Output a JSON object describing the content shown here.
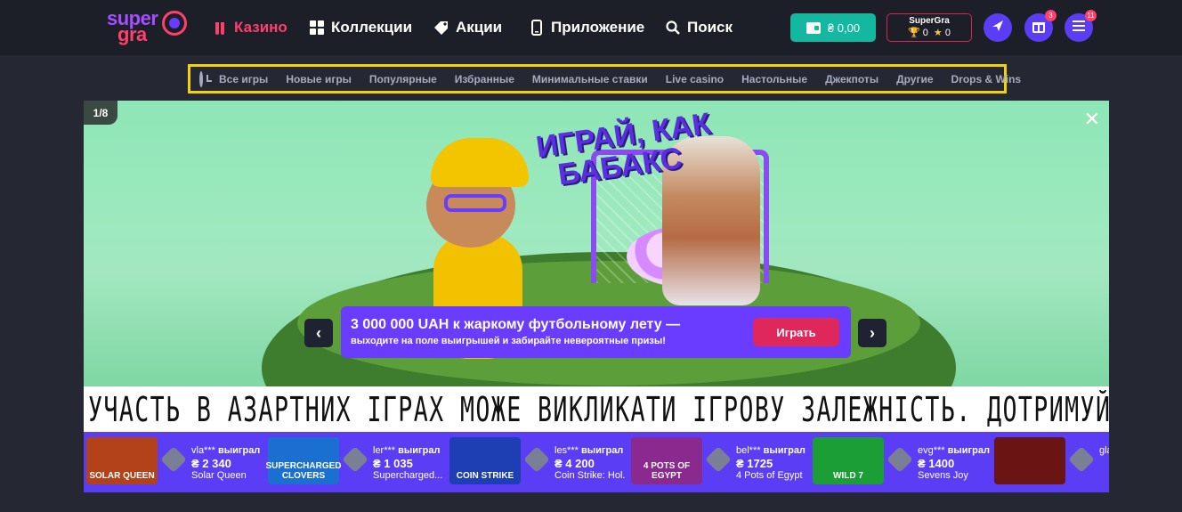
{
  "header": {
    "logo_top": "super",
    "logo_bottom": "gra",
    "nav": [
      {
        "label": "Казино",
        "icon": "casino-icon"
      },
      {
        "label": "Коллекции",
        "icon": "grid-icon"
      },
      {
        "label": "Акции",
        "icon": "tag-icon"
      },
      {
        "label": "Приложение",
        "icon": "phone-icon"
      },
      {
        "label": "Поиск",
        "icon": "search-icon"
      }
    ],
    "balance": "₴ 0,00",
    "profile": {
      "name": "SuperGra",
      "trophies": "0",
      "stars": "0"
    },
    "gift_badge": "3",
    "menu_badge": "11"
  },
  "categories": [
    "Все игры",
    "Новые игры",
    "Популярные",
    "Избранные",
    "Минимальные ставки",
    "Live casino",
    "Настольные",
    "Джекпоты",
    "Другие",
    "Drops & Wins"
  ],
  "banner": {
    "slide_counter": "1/8",
    "headline_line1": "ИГРАЙ, КАК",
    "headline_line2": "БАБАКС",
    "promo_title": "3 000 000 UAH к жаркому футбольному лету —",
    "promo_subtitle": "выходите на поле выигрышей и забирайте невероятные призы!",
    "play_button": "Играть"
  },
  "warning": "УЧАСТЬ В АЗАРТНИХ ІГРАХ МОЖЕ ВИКЛИКАТИ ІГРОВУ ЗАЛЕЖНІСТЬ. ДОТРИМУЙТЕСЯ ПРАВИЛ (ПРИНЦИПІВ) ВІДПОВІДАЛЬНОЇ ГРИ",
  "winners": [
    {
      "user": "vla***",
      "action": "выиграл",
      "amount": "₴ 2 340",
      "game": "Solar Queen",
      "thumb": "SOLAR QUEEN",
      "color": "#b3421b"
    },
    {
      "user": "ler***",
      "action": "выиграл",
      "amount": "₴ 1 035",
      "game": "Supercharged...",
      "thumb": "SUPERCHARGED CLOVERS",
      "color": "#1b6fd1"
    },
    {
      "user": "les***",
      "action": "выиграл",
      "amount": "₴ 4 200",
      "game": "Coin Strike: Hol...",
      "thumb": "COIN STRIKE",
      "color": "#1d3fb3"
    },
    {
      "user": "bel***",
      "action": "выиграл",
      "amount": "₴ 1725",
      "game": "4 Pots of Egypt",
      "thumb": "4 POTS OF EGYPT",
      "color": "#8a2a8e"
    },
    {
      "user": "evg***",
      "action": "выиграл",
      "amount": "₴ 1400",
      "game": "Sevens Joy",
      "thumb": "WILD 7",
      "color": "#1b9e35"
    },
    {
      "user": "gla***",
      "action": "",
      "amount": "",
      "game": "",
      "thumb": "",
      "color": "#6b1414"
    }
  ]
}
